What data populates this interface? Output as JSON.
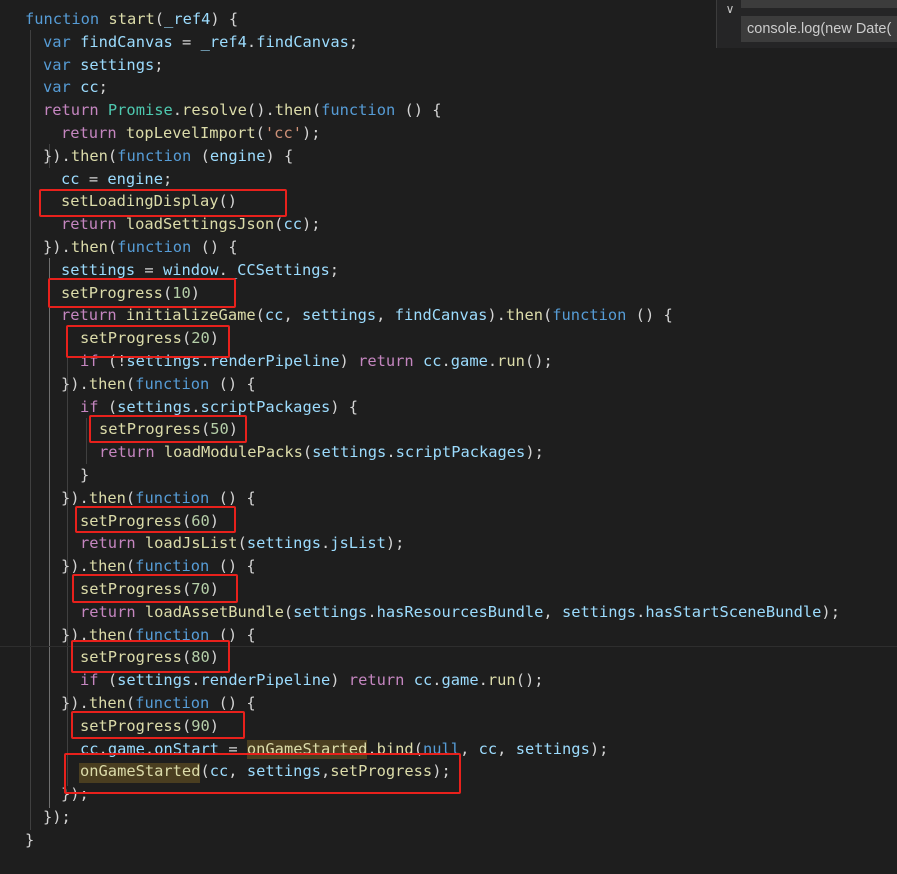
{
  "editor": {
    "lines": [
      [
        [
          "kw",
          "function"
        ],
        [
          "p",
          " "
        ],
        [
          "fn",
          "start"
        ],
        [
          "p",
          "("
        ],
        [
          "var",
          "_ref4"
        ],
        [
          "p",
          ") {"
        ]
      ],
      [
        [
          "kw",
          "var"
        ],
        [
          "p",
          " "
        ],
        [
          "var",
          "findCanvas"
        ],
        [
          "p",
          " = "
        ],
        [
          "var",
          "_ref4"
        ],
        [
          "p",
          "."
        ],
        [
          "var",
          "findCanvas"
        ],
        [
          "p",
          ";"
        ]
      ],
      [
        [
          "kw",
          "var"
        ],
        [
          "p",
          " "
        ],
        [
          "var",
          "settings"
        ],
        [
          "p",
          ";"
        ]
      ],
      [
        [
          "kw",
          "var"
        ],
        [
          "p",
          " "
        ],
        [
          "var",
          "cc"
        ],
        [
          "p",
          ";"
        ]
      ],
      [
        [
          "kw2",
          "return"
        ],
        [
          "p",
          " "
        ],
        [
          "cls",
          "Promise"
        ],
        [
          "p",
          "."
        ],
        [
          "fn",
          "resolve"
        ],
        [
          "p",
          "()."
        ],
        [
          "fn",
          "then"
        ],
        [
          "p",
          "("
        ],
        [
          "kw",
          "function"
        ],
        [
          "p",
          " () {"
        ]
      ],
      [
        [
          "kw2",
          "return"
        ],
        [
          "p",
          " "
        ],
        [
          "fn",
          "topLevelImport"
        ],
        [
          "p",
          "("
        ],
        [
          "str",
          "'cc'"
        ],
        [
          "p",
          ");"
        ]
      ],
      [
        [
          "p",
          "})."
        ],
        [
          "fn",
          "then"
        ],
        [
          "p",
          "("
        ],
        [
          "kw",
          "function"
        ],
        [
          "p",
          " ("
        ],
        [
          "var",
          "engine"
        ],
        [
          "p",
          ") {"
        ]
      ],
      [
        [
          "var",
          "cc"
        ],
        [
          "p",
          " = "
        ],
        [
          "var",
          "engine"
        ],
        [
          "p",
          ";"
        ]
      ],
      [
        [
          "fn",
          "setLoadingDisplay"
        ],
        [
          "p",
          "()"
        ]
      ],
      [
        [
          "kw2",
          "return"
        ],
        [
          "p",
          " "
        ],
        [
          "fn",
          "loadSettingsJson"
        ],
        [
          "p",
          "("
        ],
        [
          "var",
          "cc"
        ],
        [
          "p",
          ");"
        ]
      ],
      [
        [
          "p",
          "})."
        ],
        [
          "fn",
          "then"
        ],
        [
          "p",
          "("
        ],
        [
          "kw",
          "function"
        ],
        [
          "p",
          " () {"
        ]
      ],
      [
        [
          "var",
          "settings"
        ],
        [
          "p",
          " = "
        ],
        [
          "var",
          "window"
        ],
        [
          "p",
          "."
        ],
        [
          "var",
          "_CCSettings"
        ],
        [
          "p",
          ";"
        ]
      ],
      [
        [
          "fn",
          "setProgress"
        ],
        [
          "p",
          "("
        ],
        [
          "num",
          "10"
        ],
        [
          "p",
          ")"
        ]
      ],
      [
        [
          "kw2",
          "return"
        ],
        [
          "p",
          " "
        ],
        [
          "fn",
          "initializeGame"
        ],
        [
          "p",
          "("
        ],
        [
          "var",
          "cc"
        ],
        [
          "p",
          ", "
        ],
        [
          "var",
          "settings"
        ],
        [
          "p",
          ", "
        ],
        [
          "var",
          "findCanvas"
        ],
        [
          "p",
          ")."
        ],
        [
          "fn",
          "then"
        ],
        [
          "p",
          "("
        ],
        [
          "kw",
          "function"
        ],
        [
          "p",
          " () {"
        ]
      ],
      [
        [
          "fn",
          "setProgress"
        ],
        [
          "p",
          "("
        ],
        [
          "num",
          "20"
        ],
        [
          "p",
          ")"
        ]
      ],
      [
        [
          "kw2",
          "if"
        ],
        [
          "p",
          " (!"
        ],
        [
          "var",
          "settings"
        ],
        [
          "p",
          "."
        ],
        [
          "var",
          "renderPipeline"
        ],
        [
          "p",
          ") "
        ],
        [
          "kw2",
          "return"
        ],
        [
          "p",
          " "
        ],
        [
          "var",
          "cc"
        ],
        [
          "p",
          "."
        ],
        [
          "var",
          "game"
        ],
        [
          "p",
          "."
        ],
        [
          "fn",
          "run"
        ],
        [
          "p",
          "();"
        ]
      ],
      [
        [
          "p",
          "})."
        ],
        [
          "fn",
          "then"
        ],
        [
          "p",
          "("
        ],
        [
          "kw",
          "function"
        ],
        [
          "p",
          " () {"
        ]
      ],
      [
        [
          "kw2",
          "if"
        ],
        [
          "p",
          " ("
        ],
        [
          "var",
          "settings"
        ],
        [
          "p",
          "."
        ],
        [
          "var",
          "scriptPackages"
        ],
        [
          "p",
          ") {"
        ]
      ],
      [
        [
          "fn",
          "setProgress"
        ],
        [
          "p",
          "("
        ],
        [
          "num",
          "50"
        ],
        [
          "p",
          ")"
        ]
      ],
      [
        [
          "kw2",
          "return"
        ],
        [
          "p",
          " "
        ],
        [
          "fn",
          "loadModulePacks"
        ],
        [
          "p",
          "("
        ],
        [
          "var",
          "settings"
        ],
        [
          "p",
          "."
        ],
        [
          "var",
          "scriptPackages"
        ],
        [
          "p",
          ");"
        ]
      ],
      [
        [
          "p",
          "}"
        ]
      ],
      [
        [
          "p",
          "})."
        ],
        [
          "fn",
          "then"
        ],
        [
          "p",
          "("
        ],
        [
          "kw",
          "function"
        ],
        [
          "p",
          " () {"
        ]
      ],
      [
        [
          "fn",
          "setProgress"
        ],
        [
          "p",
          "("
        ],
        [
          "num",
          "60"
        ],
        [
          "p",
          ")"
        ]
      ],
      [
        [
          "kw2",
          "return"
        ],
        [
          "p",
          " "
        ],
        [
          "fn",
          "loadJsList"
        ],
        [
          "p",
          "("
        ],
        [
          "var",
          "settings"
        ],
        [
          "p",
          "."
        ],
        [
          "var",
          "jsList"
        ],
        [
          "p",
          ");"
        ]
      ],
      [
        [
          "p",
          "})."
        ],
        [
          "fn",
          "then"
        ],
        [
          "p",
          "("
        ],
        [
          "kw",
          "function"
        ],
        [
          "p",
          " () {"
        ]
      ],
      [
        [
          "fn",
          "setProgress"
        ],
        [
          "p",
          "("
        ],
        [
          "num",
          "70"
        ],
        [
          "p",
          ")"
        ]
      ],
      [
        [
          "kw2",
          "return"
        ],
        [
          "p",
          " "
        ],
        [
          "fn",
          "loadAssetBundle"
        ],
        [
          "p",
          "("
        ],
        [
          "var",
          "settings"
        ],
        [
          "p",
          "."
        ],
        [
          "var",
          "hasResourcesBundle"
        ],
        [
          "p",
          ", "
        ],
        [
          "var",
          "settings"
        ],
        [
          "p",
          "."
        ],
        [
          "var",
          "hasStartSceneBundle"
        ],
        [
          "p",
          ");"
        ]
      ],
      [
        [
          "p",
          "})."
        ],
        [
          "fn",
          "then"
        ],
        [
          "p",
          "("
        ],
        [
          "kw",
          "function"
        ],
        [
          "p",
          " () {"
        ]
      ],
      [
        [
          "fn",
          "setProgress"
        ],
        [
          "p",
          "("
        ],
        [
          "num",
          "80"
        ],
        [
          "p",
          ")"
        ]
      ],
      [
        [
          "kw2",
          "if"
        ],
        [
          "p",
          " ("
        ],
        [
          "var",
          "settings"
        ],
        [
          "p",
          "."
        ],
        [
          "var",
          "renderPipeline"
        ],
        [
          "p",
          ") "
        ],
        [
          "kw2",
          "return"
        ],
        [
          "p",
          " "
        ],
        [
          "var",
          "cc"
        ],
        [
          "p",
          "."
        ],
        [
          "var",
          "game"
        ],
        [
          "p",
          "."
        ],
        [
          "fn",
          "run"
        ],
        [
          "p",
          "();"
        ]
      ],
      [
        [
          "p",
          "})."
        ],
        [
          "fn",
          "then"
        ],
        [
          "p",
          "("
        ],
        [
          "kw",
          "function"
        ],
        [
          "p",
          " () {"
        ]
      ],
      [
        [
          "fn",
          "setProgress"
        ],
        [
          "p",
          "("
        ],
        [
          "num",
          "90"
        ],
        [
          "p",
          ")"
        ]
      ],
      [
        [
          "var",
          "cc"
        ],
        [
          "p",
          "."
        ],
        [
          "var",
          "game"
        ],
        [
          "p",
          "."
        ],
        [
          "var",
          "onStart"
        ],
        [
          "p",
          " = "
        ],
        [
          "fn",
          "onGameStarted"
        ],
        [
          "p",
          "."
        ],
        [
          "fn",
          "bind"
        ],
        [
          "p",
          "("
        ],
        [
          "kw",
          "null"
        ],
        [
          "p",
          ", "
        ],
        [
          "var",
          "cc"
        ],
        [
          "p",
          ", "
        ],
        [
          "var",
          "settings"
        ],
        [
          "p",
          ");"
        ]
      ],
      [
        [
          "fn",
          "onGameStarted"
        ],
        [
          "p",
          "("
        ],
        [
          "var",
          "cc"
        ],
        [
          "p",
          ", "
        ],
        [
          "var",
          "settings"
        ],
        [
          "p",
          ","
        ],
        [
          "fn",
          "setProgress"
        ],
        [
          "p",
          ");"
        ]
      ],
      [
        [
          "p",
          "});"
        ]
      ],
      [
        [
          "p",
          "});"
        ]
      ],
      [
        [
          "p",
          "}"
        ]
      ]
    ]
  },
  "find_widget": {
    "chevron": "∨",
    "search_value": "console.log(new Date("
  },
  "colors": {
    "background": "#1e1e1e",
    "highlight_box": "#e8211c",
    "keyword": "#569cd6",
    "control": "#c586c0",
    "function": "#dcdcaa",
    "variable": "#9cdcfe",
    "class": "#4ec9b0",
    "number": "#b5cea8",
    "string": "#ce9178"
  }
}
